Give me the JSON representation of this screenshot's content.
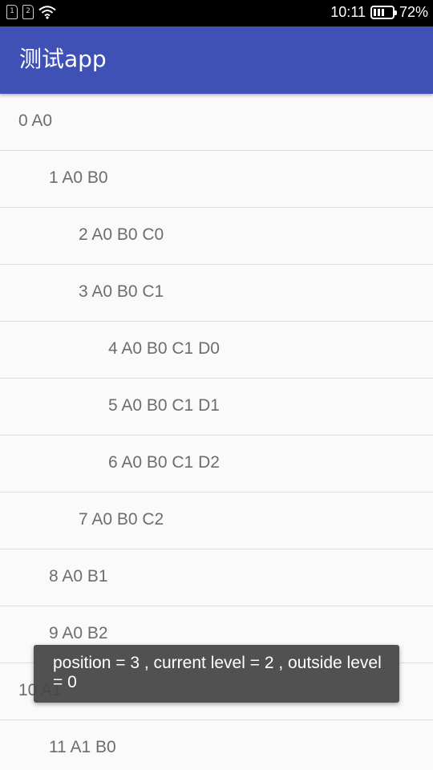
{
  "status_bar": {
    "sim1_label": "1",
    "sim2_label": "2",
    "time": "10:11",
    "battery_percent": "72%",
    "battery_level": 0.72,
    "icons": [
      "sim-card-icon",
      "sim-card-icon",
      "wifi-icon",
      "battery-icon"
    ]
  },
  "app_bar": {
    "title": "测试app",
    "color": "#3f51b5"
  },
  "list": {
    "items": [
      {
        "label": "0 A0",
        "level": 0
      },
      {
        "label": "1 A0 B0",
        "level": 1
      },
      {
        "label": "2 A0 B0 C0",
        "level": 2
      },
      {
        "label": "3 A0 B0 C1",
        "level": 2
      },
      {
        "label": "4 A0 B0 C1 D0",
        "level": 3
      },
      {
        "label": "5 A0 B0 C1 D1",
        "level": 3
      },
      {
        "label": "6 A0 B0 C1 D2",
        "level": 3
      },
      {
        "label": "7 A0 B0 C2",
        "level": 2
      },
      {
        "label": "8 A0 B1",
        "level": 1
      },
      {
        "label": "9 A0 B2",
        "level": 1
      },
      {
        "label": "10 A1",
        "level": 0
      },
      {
        "label": "11 A1 B0",
        "level": 1
      }
    ]
  },
  "toast": {
    "message": "position = 3 , current level = 2 , outside level = 0"
  }
}
